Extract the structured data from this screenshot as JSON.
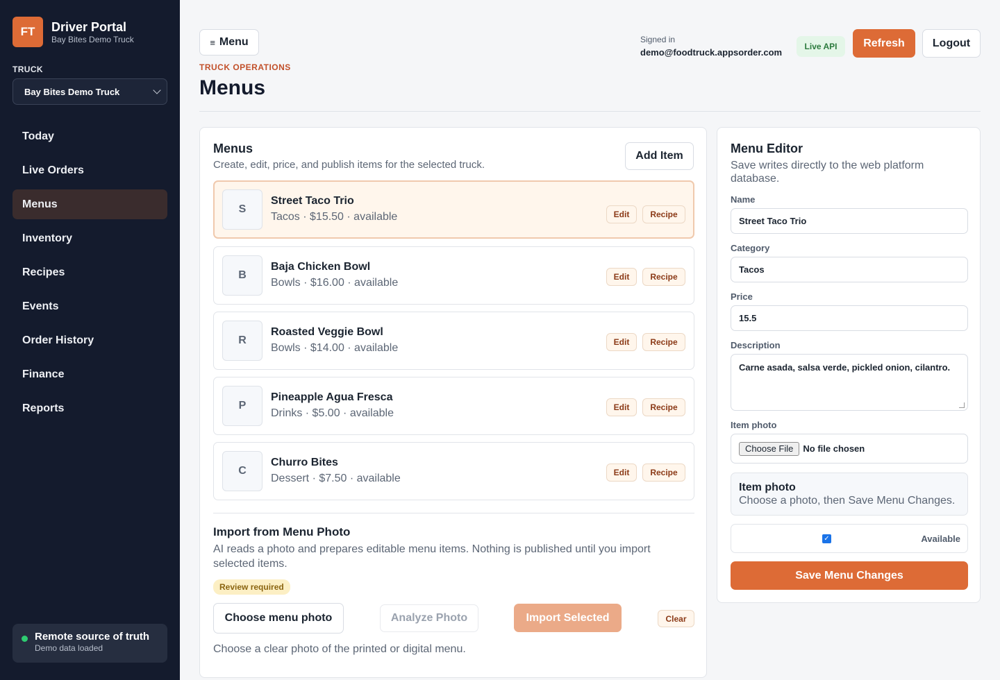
{
  "brand": {
    "logo_initials": "FT",
    "title": "Driver Portal",
    "subtitle": "Bay Bites Demo Truck"
  },
  "truck": {
    "label": "TRUCK",
    "selected": "Bay Bites Demo Truck"
  },
  "nav": [
    {
      "label": "Today",
      "active": false
    },
    {
      "label": "Live Orders",
      "active": false
    },
    {
      "label": "Menus",
      "active": true
    },
    {
      "label": "Inventory",
      "active": false
    },
    {
      "label": "Recipes",
      "active": false
    },
    {
      "label": "Events",
      "active": false
    },
    {
      "label": "Order History",
      "active": false
    },
    {
      "label": "Finance",
      "active": false
    },
    {
      "label": "Reports",
      "active": false
    }
  ],
  "sync": {
    "title": "Remote source of truth",
    "subtitle": "Demo data loaded",
    "status_color": "#2ecc71"
  },
  "header": {
    "menu_button": "Menu",
    "menu_icon": "≡",
    "eyebrow": "TRUCK OPERATIONS",
    "title": "Menus",
    "signed_in_label": "Signed in",
    "email": "demo@foodtruck.appsorder.com",
    "api_badge": "Live API",
    "refresh": "Refresh",
    "logout": "Logout"
  },
  "menus": {
    "title": "Menus",
    "subtitle": "Create, edit, price, and publish items for the selected truck.",
    "add_item": "Add Item",
    "items": [
      {
        "initial": "S",
        "name": "Street Taco Trio",
        "meta": "Tacos · $15.50 · available",
        "edit": "Edit",
        "recipe": "Recipe"
      },
      {
        "initial": "B",
        "name": "Baja Chicken Bowl",
        "meta": "Bowls · $16.00 · available",
        "edit": "Edit",
        "recipe": "Recipe"
      },
      {
        "initial": "R",
        "name": "Roasted Veggie Bowl",
        "meta": "Bowls · $14.00 · available",
        "edit": "Edit",
        "recipe": "Recipe"
      },
      {
        "initial": "P",
        "name": "Pineapple Agua Fresca",
        "meta": "Drinks · $5.00 · available",
        "edit": "Edit",
        "recipe": "Recipe"
      },
      {
        "initial": "C",
        "name": "Churro Bites",
        "meta": "Dessert · $7.50 · available",
        "edit": "Edit",
        "recipe": "Recipe"
      }
    ],
    "selected_index": 0
  },
  "import": {
    "title": "Import from Menu Photo",
    "subtitle": "AI reads a photo and prepares editable menu items. Nothing is published until you import selected items.",
    "badge": "Review required",
    "choose": "Choose menu photo",
    "analyze": "Analyze Photo",
    "import_selected": "Import Selected",
    "clear": "Clear",
    "hint": "Choose a clear photo of the printed or digital menu."
  },
  "editor": {
    "title": "Menu Editor",
    "subtitle": "Save writes directly to the web platform database.",
    "name_label": "Name",
    "name_value": "Street Taco Trio",
    "category_label": "Category",
    "category_value": "Tacos",
    "price_label": "Price",
    "price_value": "15.5",
    "description_label": "Description",
    "description_value": "Carne asada, salsa verde, pickled onion, cilantro.",
    "photo_label": "Item photo",
    "file_button": "Choose File",
    "file_status": "No file chosen",
    "photo_box_title": "Item photo",
    "photo_box_sub": "Choose a photo, then Save Menu Changes.",
    "available_label": "Available",
    "available_checked": true,
    "save": "Save Menu Changes"
  },
  "colors": {
    "accent": "#dd6b36",
    "sidebar": "#141b2d",
    "live_green": "#2b7a3d"
  }
}
